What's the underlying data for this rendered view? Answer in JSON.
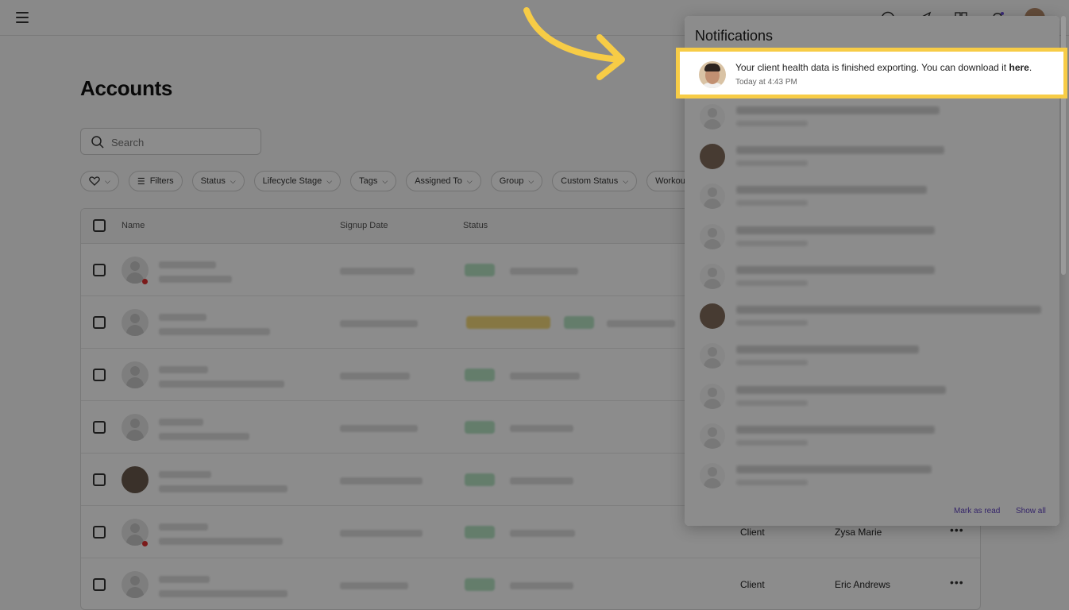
{
  "app": {
    "page_title": "Accounts",
    "search_placeholder": "Search",
    "filters": [
      "Filters",
      "Status",
      "Lifecycle Stage",
      "Tags",
      "Assigned To",
      "Group",
      "Custom Status",
      "Workout"
    ],
    "columns": [
      "Name",
      "Signup Date",
      "Status"
    ],
    "rows": [
      {
        "role": "",
        "coach": ""
      },
      {
        "role": "",
        "coach": ""
      },
      {
        "role": "",
        "coach": ""
      },
      {
        "role": "",
        "coach": ""
      },
      {
        "role": "",
        "coach": ""
      },
      {
        "role": "Client",
        "coach": "Zysa Marie"
      },
      {
        "role": "Client",
        "coach": "Eric Andrews"
      }
    ]
  },
  "notifications": {
    "title": "Notifications",
    "highlighted": {
      "text": "Your client health data is finished exporting. You can download it",
      "link": "here",
      "suffix": ".",
      "time": "Today at 4:43 PM"
    },
    "mark_as_read": "Mark as read",
    "show_all": "Show all"
  },
  "colors": {
    "highlight_border": "#f7cc46",
    "link_purple": "#5a3fb5",
    "overlay": "rgba(0,0,0,0.45)"
  }
}
